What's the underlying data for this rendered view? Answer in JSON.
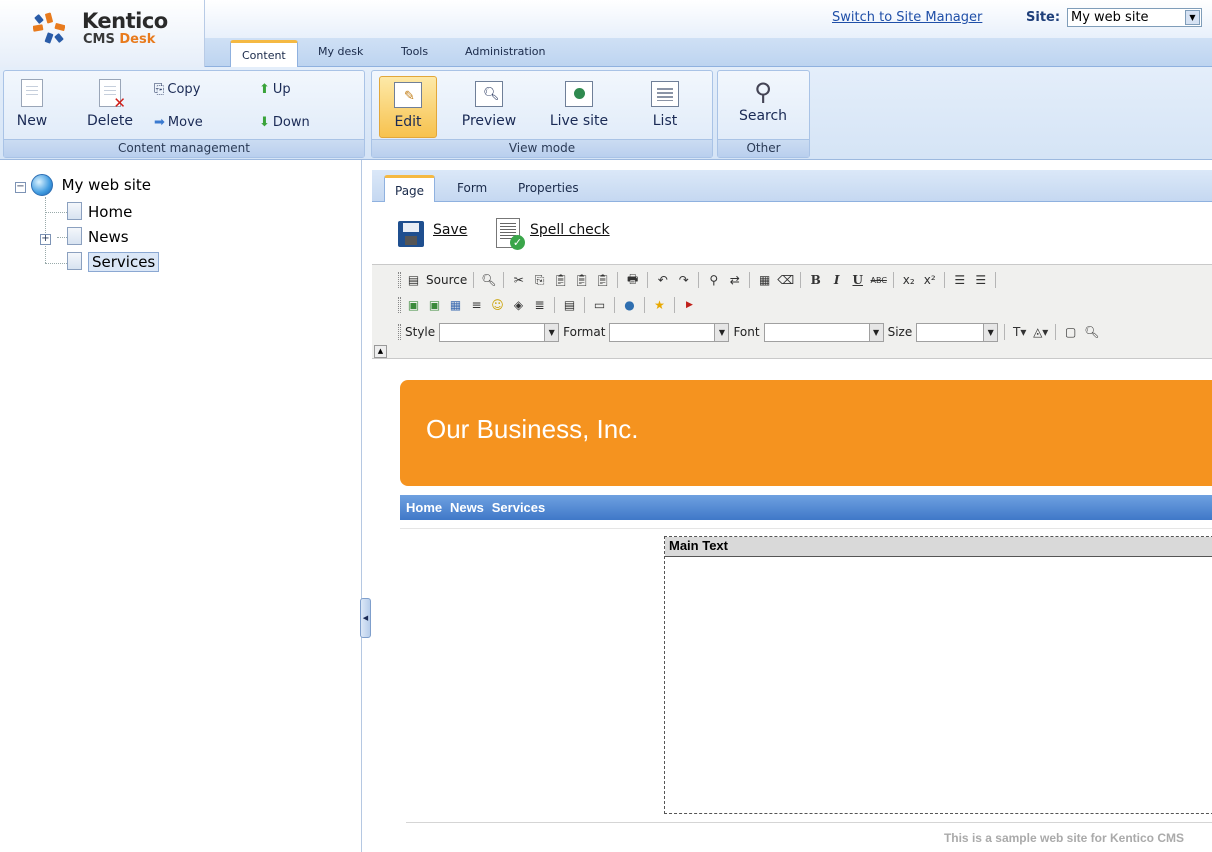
{
  "app": {
    "brand": "Kentico",
    "product_prefix": "CMS",
    "product_suffix": "Desk"
  },
  "header": {
    "switch_link": "Switch to Site Manager",
    "site_label": "Site:",
    "site_value": "My web site"
  },
  "top_tabs": [
    {
      "label": "Content",
      "active": true
    },
    {
      "label": "My desk"
    },
    {
      "label": "Tools"
    },
    {
      "label": "Administration"
    }
  ],
  "ribbon": {
    "content_management": {
      "label": "Content management",
      "new": "New",
      "delete": "Delete",
      "copy": "Copy",
      "move": "Move",
      "up": "Up",
      "down": "Down"
    },
    "view_mode": {
      "label": "View mode",
      "edit": "Edit",
      "preview": "Preview",
      "live_site": "Live site",
      "list": "List"
    },
    "other": {
      "label": "Other",
      "search": "Search"
    }
  },
  "tree": {
    "root": "My web site",
    "items": [
      {
        "label": "Home"
      },
      {
        "label": "News",
        "expandable": true
      },
      {
        "label": "Services",
        "selected": true
      }
    ]
  },
  "sub_tabs": [
    {
      "label": "Page",
      "active": true
    },
    {
      "label": "Form"
    },
    {
      "label": "Properties"
    }
  ],
  "actions": {
    "save": "Save",
    "spell_check": "Spell check"
  },
  "editor": {
    "source_label": "Source",
    "style_label": "Style",
    "format_label": "Format",
    "font_label": "Font",
    "size_label": "Size"
  },
  "page": {
    "banner_title": "Our Business, Inc.",
    "menu": [
      "Home",
      "News",
      "Services"
    ],
    "main_text_header": "Main Text",
    "footer": "This is a sample web site for Kentico CMS"
  },
  "colors": {
    "banner": "#f5931f",
    "menu_bar": "#3f78c8",
    "active_view_button": "#f7c24e",
    "brand_orange": "#e87b1e"
  }
}
